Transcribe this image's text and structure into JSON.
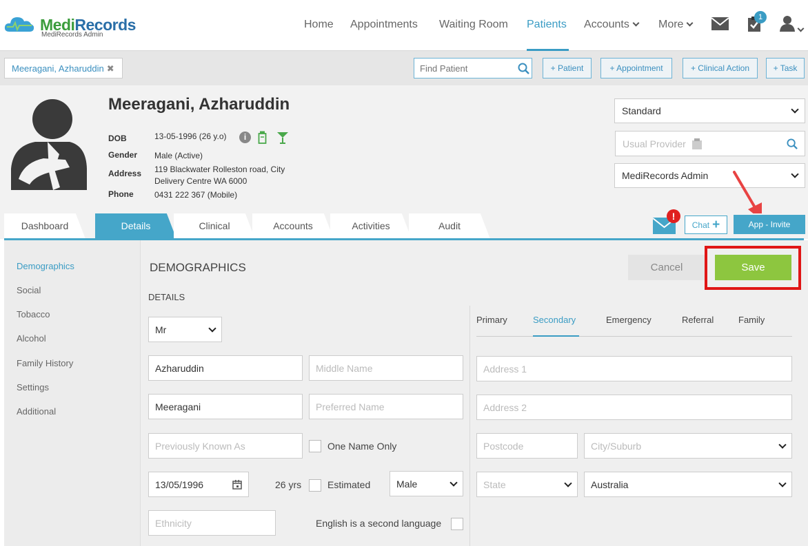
{
  "app": {
    "logo_left": "Medi",
    "logo_right": "Records",
    "logo_sub": "MediRecords Admin"
  },
  "nav": {
    "home": "Home",
    "appointments": "Appointments",
    "waiting_room": "Waiting Room",
    "patients": "Patients",
    "accounts": "Accounts",
    "more": "More",
    "tasks_badge": "1"
  },
  "toolbar": {
    "patient_tab": "Meeragani, Azharuddin",
    "find_placeholder": "Find Patient",
    "add_patient": "+ Patient",
    "add_appointment": "+ Appointment",
    "add_clinical_action": "+ Clinical Action",
    "add_task": "+ Task"
  },
  "patient": {
    "name": "Meeragani, Azharuddin",
    "dob_label": "DOB",
    "dob": "13-05-1996 (26 y.o)",
    "gender_label": "Gender",
    "gender": "Male (Active)",
    "address_label": "Address",
    "address_line1": "119 Blackwater Rolleston road, City",
    "address_line2": "Delivery Centre WA 6000",
    "phone_label": "Phone",
    "phone": "0431 222 367 (Mobile)"
  },
  "right_panel": {
    "billing_type": "Standard",
    "usual_provider_placeholder": "Usual Provider",
    "practitioner": "MediRecords Admin",
    "chat": "Chat",
    "app_invite": "App - Invite",
    "alert_glyph": "!"
  },
  "tabs": [
    "Dashboard",
    "Details",
    "Clinical",
    "Accounts",
    "Activities",
    "Audit"
  ],
  "leftnav": [
    "Demographics",
    "Social",
    "Tobacco",
    "Alcohol",
    "Family History",
    "Settings",
    "Additional"
  ],
  "form": {
    "section_title": "DEMOGRAPHICS",
    "details_title": "DETAILS",
    "cancel": "Cancel",
    "save": "Save",
    "title_value": "Mr",
    "first_name": "Azharuddin",
    "middle_name_ph": "Middle Name",
    "last_name": "Meeragani",
    "preferred_name_ph": "Preferred Name",
    "previously_known_ph": "Previously Known As",
    "one_name_only": "One Name Only",
    "dob_value": "13/05/1996",
    "age": "26 yrs",
    "estimated": "Estimated",
    "sex_value": "Male",
    "ethnicity_ph": "Ethnicity",
    "english_second": "English is a second language"
  },
  "address": {
    "tabs": [
      "Primary",
      "Secondary",
      "Emergency",
      "Referral",
      "Family"
    ],
    "address1_ph": "Address 1",
    "address2_ph": "Address 2",
    "postcode_ph": "Postcode",
    "city_ph": "City/Suburb",
    "state_ph": "State",
    "country": "Australia"
  }
}
